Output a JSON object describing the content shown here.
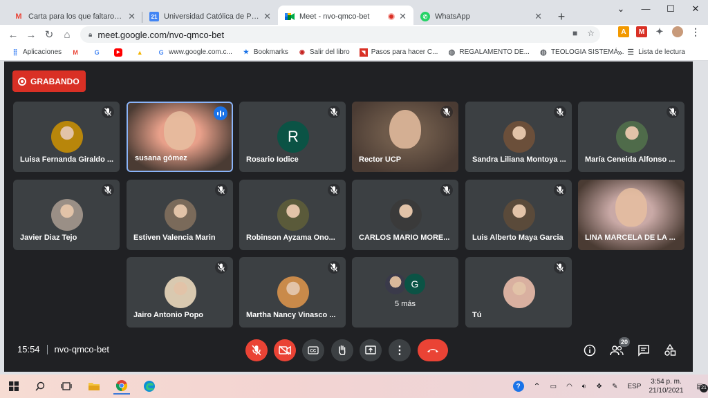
{
  "browser": {
    "tabs": [
      {
        "title": "Carta para los que faltaron el sáb",
        "icon": "gmail-icon",
        "active": false
      },
      {
        "title": "Universidad Católica de Pereira -",
        "icon": "calendar-icon",
        "active": false
      },
      {
        "title": "Meet - nvo-qmco-bet",
        "icon": "meet-icon",
        "active": true
      },
      {
        "title": "WhatsApp",
        "icon": "whatsapp-icon",
        "active": false
      }
    ],
    "calendar_day": "21",
    "url": "meet.google.com/nvo-qmco-bet",
    "bookmarks": [
      {
        "label": "Aplicaciones",
        "icon": "apps-icon"
      },
      {
        "label": "",
        "icon": "gmail-icon"
      },
      {
        "label": "",
        "icon": "google-icon"
      },
      {
        "label": "",
        "icon": "youtube-icon"
      },
      {
        "label": "",
        "icon": "drive-icon"
      },
      {
        "label": "www.google.com.c...",
        "icon": "google-icon"
      },
      {
        "label": "Bookmarks",
        "icon": "star-icon"
      },
      {
        "label": "Salir del libro",
        "icon": "record-icon"
      },
      {
        "label": "Pasos para hacer C...",
        "icon": "bookmark-icon"
      },
      {
        "label": "REGALAMENTO DE...",
        "icon": "globe-icon"
      },
      {
        "label": "TEOLOGIA SISTEMÁ...",
        "icon": "globe-icon"
      }
    ],
    "more_bookmarks": "»",
    "reading_list": "Lista de lectura"
  },
  "meet": {
    "recording_label": "GRABANDO",
    "participants": [
      {
        "name": "Luisa Fernanda Giraldo ...",
        "kind": "avatar",
        "color": "#b8860b"
      },
      {
        "name": "susana gómez",
        "kind": "video",
        "active": true,
        "color": "#e8a08a"
      },
      {
        "name": "Rosario Iodice",
        "kind": "letter",
        "letter": "R"
      },
      {
        "name": "Rector UCP",
        "kind": "video",
        "color": "#6e5a4a"
      },
      {
        "name": "Sandra Liliana Montoya ...",
        "kind": "avatar",
        "color": "#6b4f3a"
      },
      {
        "name": "María Ceneida Alfonso ...",
        "kind": "avatar",
        "color": "#4f6b4a"
      },
      {
        "name": "Javier Diaz Tejo",
        "kind": "avatar",
        "color": "#9a8f86"
      },
      {
        "name": "Estiven Valencia Marin",
        "kind": "avatar",
        "color": "#7a6a5a"
      },
      {
        "name": "Robinson Ayzama Ono...",
        "kind": "avatar",
        "color": "#5a5a3a"
      },
      {
        "name": "CARLOS MARIO MORE...",
        "kind": "avatar",
        "color": "#3a3a3a"
      },
      {
        "name": "Luis Alberto Maya Garcia",
        "kind": "avatar",
        "color": "#5a4a3a"
      },
      {
        "name": "LINA MARCELA DE LA ...",
        "kind": "video",
        "color": "#c9a9a6"
      },
      {
        "name": "Jairo Antonio Popo",
        "kind": "avatar",
        "color": "#d9c9b0"
      },
      {
        "name": "Martha Nancy Vinasco ...",
        "kind": "avatar",
        "color": "#c98a4a"
      },
      {
        "name": "5 más",
        "kind": "more",
        "letter": "G"
      },
      {
        "name": "Tú",
        "kind": "avatar",
        "color": "#d9b0a0"
      }
    ],
    "time": "15:54",
    "meeting_code": "nvo-qmco-bet",
    "people_count": "20"
  },
  "taskbar": {
    "language": "ESP",
    "time": "3:54 p. m.",
    "date": "21/10/2021",
    "notification_count": "21"
  }
}
